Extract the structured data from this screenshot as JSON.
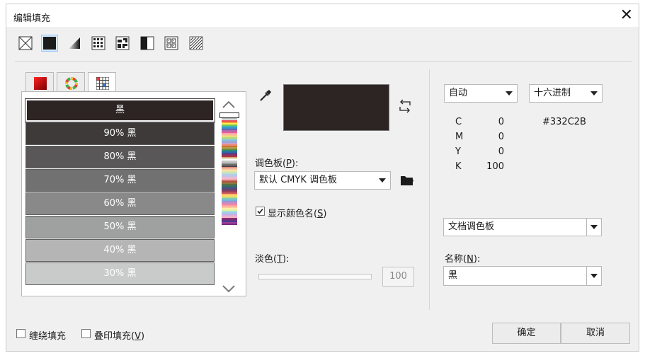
{
  "dialog": {
    "title": "编辑填充",
    "close_symbol": "✕"
  },
  "fill_types": [
    {
      "name": "no-fill",
      "icon": "no-fill-icon",
      "selected": false
    },
    {
      "name": "uniform-fill",
      "icon": "uniform-fill-icon",
      "selected": true
    },
    {
      "name": "fountain-fill",
      "icon": "fountain-fill-icon",
      "selected": false
    },
    {
      "name": "vector-pattern-fill",
      "icon": "vector-pattern-icon",
      "selected": false
    },
    {
      "name": "bitmap-pattern-fill",
      "icon": "bitmap-pattern-icon",
      "selected": false
    },
    {
      "name": "two-color-pattern-fill",
      "icon": "two-color-pattern-icon",
      "selected": false
    },
    {
      "name": "texture-fill",
      "icon": "texture-fill-icon",
      "selected": false
    },
    {
      "name": "postscript-fill",
      "icon": "postscript-fill-icon",
      "selected": false
    }
  ],
  "tabs": [
    {
      "name": "models",
      "icon": "color-model-icon",
      "selected": false
    },
    {
      "name": "mixers",
      "icon": "color-wheel-icon",
      "selected": false
    },
    {
      "name": "palettes",
      "icon": "palette-grid-icon",
      "selected": true
    }
  ],
  "swatches": [
    {
      "label": "黑",
      "color": "#2d2523",
      "selected": true
    },
    {
      "label": "90% 黑",
      "color": "#3e3a39"
    },
    {
      "label": "80% 黑",
      "color": "#595757"
    },
    {
      "label": "70% 黑",
      "color": "#727171"
    },
    {
      "label": "60% 黑",
      "color": "#898989"
    },
    {
      "label": "50% 黑",
      "color": "#9fa0a0"
    },
    {
      "label": "40% 黑",
      "color": "#b5b5b6"
    },
    {
      "label": "30% 黑",
      "color": "#c9caca"
    }
  ],
  "palette_strip": [
    "#2d2523",
    "#595757",
    "#898989",
    "#b5b5b6",
    "#d8d8d8",
    "#e84c55",
    "#f29b3a",
    "#fff04a",
    "#74c15e",
    "#3fb8b0",
    "#3a8ed0",
    "#6a63b1",
    "#b06aa8",
    "#e0609e",
    "#f4a2b0",
    "#f7c98b",
    "#e8e07b",
    "#b5d87c",
    "#8fd1c7",
    "#8fb8e3",
    "#a4a2cf",
    "#c8a1cc",
    "#ed8a6e",
    "#c7752d",
    "#bd9c57",
    "#6a8e39",
    "#2b8a7a",
    "#2b6aa5",
    "#553f8c",
    "#86306e",
    "#a63c3c",
    "#d0a777",
    "#ffffff",
    "#e5e5e5",
    "#c0c0c0",
    "#9a9a9a",
    "#707070",
    "#4a4a4a",
    "#e98a7e",
    "#f3c6a6",
    "#fbe3a4",
    "#d9e7a9",
    "#b9dfd4",
    "#b2cfe9",
    "#c8c1e2",
    "#e3bedc",
    "#f0b7c0",
    "#d8736e",
    "#ad5745",
    "#8a7a3f",
    "#5c6f3e",
    "#3e6b66",
    "#3a5c82",
    "#574877",
    "#7a3f67",
    "#9a4258",
    "#cf5f5a",
    "#ffb76b",
    "#ffd872",
    "#c1db74",
    "#7fcfb9",
    "#79b4de",
    "#9c94cf",
    "#cf8cc3",
    "#ee86a5",
    "#f7a4a4",
    "#ffcb9c",
    "#fff0a6",
    "#e2efa8",
    "#a9e0d4",
    "#a6c9ee",
    "#bfb3e2",
    "#deaed9",
    "#f6b3c8",
    "#8d2f6b",
    "#6d2f82",
    "#4a3c8c",
    "#9d3e9a",
    "#7c2a7e"
  ],
  "eyedropper_icon": "eyedropper-icon",
  "preview_color": "#2d2523",
  "swap_icon": "swap-colors-icon",
  "palette": {
    "label_prefix": "调色板(",
    "label_key": "P",
    "label_suffix": "):",
    "value": "默认 CMYK 调色板",
    "folder_icon": "open-folder-icon"
  },
  "show_names": {
    "checked": true,
    "label_prefix": "显示颜色名(",
    "label_key": "S",
    "label_suffix": ")"
  },
  "tint": {
    "label_prefix": "淡色(",
    "label_key": "T",
    "label_suffix": "):",
    "value": "100"
  },
  "right": {
    "model_select": "自动",
    "format_select": "十六进制",
    "hex": "#332C2B",
    "cmyk": [
      {
        "channel": "C",
        "value": "0"
      },
      {
        "channel": "M",
        "value": "0"
      },
      {
        "channel": "Y",
        "value": "0"
      },
      {
        "channel": "K",
        "value": "100"
      }
    ],
    "doc_palette": "文档调色板",
    "name_label_prefix": "名称(",
    "name_label_key": "N",
    "name_label_suffix": "):",
    "name_value": "黑"
  },
  "footer": {
    "wrap_fill": "缠绕填充",
    "overprint_prefix": "叠印填充(",
    "overprint_key": "V",
    "overprint_suffix": ")",
    "ok": "确定",
    "cancel": "取消"
  }
}
